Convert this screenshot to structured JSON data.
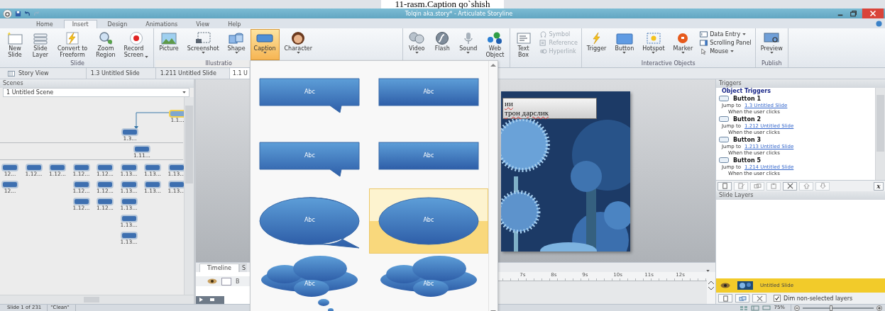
{
  "document_caption": "11-rasm.Caption qo`shish",
  "window": {
    "title": "Tolqin aka.story* -  Articulate Storyline"
  },
  "ribbon_tabs": [
    {
      "label": "Home",
      "selected": false
    },
    {
      "label": "Insert",
      "selected": true
    },
    {
      "label": "Design",
      "selected": false
    },
    {
      "label": "Animations",
      "selected": false
    },
    {
      "label": "View",
      "selected": false
    },
    {
      "label": "Help",
      "selected": false
    }
  ],
  "ribbon_groups": [
    {
      "label": "Slide",
      "buttons": [
        {
          "kind": "new-slide",
          "label": "New\nSlide",
          "dropdown": false,
          "selected": false
        },
        {
          "kind": "slide-layer",
          "label": "Slide\nLayer",
          "dropdown": false,
          "selected": false
        },
        {
          "kind": "freeform",
          "label": "Convert to\nFreeform",
          "dropdown": false,
          "selected": false
        },
        {
          "kind": "zoom",
          "label": "Zoom\nRegion",
          "dropdown": false,
          "selected": false
        },
        {
          "kind": "record",
          "label": "Record\nScreen",
          "dropdown": true,
          "selected": false
        }
      ]
    },
    {
      "label": "Illustratio",
      "buttons": [
        {
          "kind": "picture",
          "label": "Picture",
          "dropdown": false,
          "selected": false
        },
        {
          "kind": "screenshot",
          "label": "Screenshot",
          "dropdown": true,
          "selected": false
        },
        {
          "kind": "shape",
          "label": "Shape",
          "dropdown": true,
          "selected": false
        },
        {
          "kind": "caption",
          "label": "Caption",
          "dropdown": true,
          "selected": true
        },
        {
          "kind": "character",
          "label": "Character",
          "dropdown": true,
          "selected": false
        }
      ]
    },
    {
      "buttons": [
        {
          "kind": "video",
          "label": "Video",
          "dropdown": true,
          "selected": false
        },
        {
          "kind": "flash",
          "label": "Flash",
          "dropdown": false,
          "selected": false
        },
        {
          "kind": "sound",
          "label": "Sound",
          "dropdown": true,
          "selected": false
        },
        {
          "kind": "web",
          "label": "Web\nObject",
          "dropdown": false,
          "selected": false
        }
      ]
    },
    {
      "buttons": [
        {
          "kind": "textbox",
          "label": "Text\nBox",
          "dropdown": false,
          "selected": false
        }
      ],
      "small_buttons": [
        {
          "kind": "symbol",
          "label": "Symbol",
          "dropdown": false,
          "disabled": true
        },
        {
          "kind": "reference",
          "label": "Reference",
          "dropdown": false,
          "disabled": true
        },
        {
          "kind": "hyperlink",
          "label": "Hyperlink",
          "dropdown": false,
          "disabled": true
        }
      ]
    },
    {
      "label": "Interactive Objects",
      "buttons": [
        {
          "kind": "trigger",
          "label": "Trigger",
          "dropdown": false,
          "selected": false
        },
        {
          "kind": "button",
          "label": "Button",
          "dropdown": true,
          "selected": false
        },
        {
          "kind": "hotspot",
          "label": "Hotspot",
          "dropdown": true,
          "selected": false
        },
        {
          "kind": "marker",
          "label": "Marker",
          "dropdown": true,
          "selected": false
        }
      ],
      "small_buttons": [
        {
          "kind": "data-entry",
          "label": "Data Entry",
          "dropdown": true,
          "disabled": false
        },
        {
          "kind": "scrolling-panel",
          "label": "Scrolling Panel",
          "dropdown": false,
          "disabled": false
        },
        {
          "kind": "mouse",
          "label": "Mouse",
          "dropdown": true,
          "disabled": false
        }
      ]
    },
    {
      "label": "Publish",
      "buttons": [
        {
          "kind": "preview",
          "label": "Preview",
          "dropdown": true,
          "selected": false
        }
      ]
    }
  ],
  "caption_gallery": [
    {
      "kind": "rect-callout",
      "label": "Abc",
      "selected": false
    },
    {
      "kind": "rect",
      "label": "Abc",
      "selected": false
    },
    {
      "kind": "rect-callout",
      "label": "Abc",
      "selected": false
    },
    {
      "kind": "rect",
      "label": "Abc",
      "selected": false
    },
    {
      "kind": "oval-callout",
      "label": "Abc",
      "selected": false
    },
    {
      "kind": "oval",
      "label": "Abc",
      "selected": true
    },
    {
      "kind": "cloud-callout",
      "label": "Abc",
      "selected": false
    },
    {
      "kind": "cloud",
      "label": "Abc",
      "selected": false
    }
  ],
  "doc_tabs": [
    {
      "label": "Story View",
      "kind": "story",
      "selected": false
    },
    {
      "label": "1.3 Untitled Slide",
      "kind": "slide",
      "selected": false
    },
    {
      "label": "1.211 Untitled Slide",
      "kind": "slide",
      "selected": false
    },
    {
      "label": "1.1 U",
      "kind": "slide",
      "selected": true
    }
  ],
  "scenes_panel": {
    "title": "Scenes",
    "scene": "1 Untitled Scene",
    "tree": {
      "label": "1.1...",
      "selected": true,
      "children": [
        {
          "label": "1.3...",
          "selected": false,
          "children": [
            {
              "label": "1.11...",
              "selected": false,
              "children": [
                {
                  "label": "12...",
                  "selected": false,
                  "children": [
                    {
                      "label": "12...",
                      "selected": false
                    }
                  ]
                },
                {
                  "label": "1.12...",
                  "selected": false
                },
                {
                  "label": "1.12...",
                  "selected": false
                },
                {
                  "label": "1.12...",
                  "selected": false,
                  "children": [
                    {
                      "label": "1.12...",
                      "selected": false,
                      "children": [
                        {
                          "label": "1.12...",
                          "selected": false
                        }
                      ]
                    }
                  ]
                },
                {
                  "label": "1.12...",
                  "selected": false,
                  "children": [
                    {
                      "label": "1.12...",
                      "selected": false,
                      "children": [
                        {
                          "label": "1.12...",
                          "selected": false
                        }
                      ]
                    }
                  ]
                },
                {
                  "label": "1.13...",
                  "selected": false,
                  "children": [
                    {
                      "label": "1.13...",
                      "selected": false,
                      "children": [
                        {
                          "label": "1.13...",
                          "selected": false,
                          "children": [
                            {
                              "label": "1.13...",
                              "selected": false,
                              "children": [
                                {
                                  "label": "1.13...",
                                  "selected": false
                                }
                              ]
                            }
                          ]
                        }
                      ]
                    }
                  ]
                },
                {
                  "label": "1.13...",
                  "selected": false,
                  "children": [
                    {
                      "label": "1.13...",
                      "selected": false
                    }
                  ]
                },
                {
                  "label": "1.13...",
                  "selected": false,
                  "children": [
                    {
                      "label": "1.13...",
                      "selected": false
                    }
                  ]
                }
              ]
            }
          ]
        }
      ]
    }
  },
  "slide": {
    "kind": "picture",
    "text_lines": [
      "ии",
      "трон дарслик"
    ]
  },
  "timeline": {
    "tabs": [
      {
        "label": "Timeline",
        "selected": true
      },
      {
        "label": "S",
        "selected": false
      }
    ],
    "row_label": "B",
    "ruler": [
      "7s",
      "8s",
      "9s",
      "10s",
      "11s",
      "12s"
    ]
  },
  "triggers_panel": {
    "title": "Triggers",
    "heading": "Object Triggers",
    "items": [
      {
        "object": "Button 1",
        "action": "Jump to",
        "target": "1.3 Untitled Slide",
        "condition": "When the user clicks"
      },
      {
        "object": "Button 2",
        "action": "Jump to",
        "target": "1.212 Untitled Slide",
        "condition": "When the user clicks"
      },
      {
        "object": "Button 3",
        "action": "Jump to",
        "target": "1.213 Untitled Slide",
        "condition": "When the user clicks"
      },
      {
        "object": "Button 5",
        "action": "Jump to",
        "target": "1.214 Untitled Slide",
        "condition": "When the user clicks"
      }
    ],
    "toolbar": [
      {
        "kind": "new",
        "disabled": false
      },
      {
        "kind": "edit",
        "disabled": true
      },
      {
        "kind": "copy",
        "disabled": true
      },
      {
        "kind": "paste",
        "disabled": true
      },
      {
        "kind": "delete",
        "disabled": false
      },
      {
        "kind": "up",
        "disabled": true
      },
      {
        "kind": "down",
        "disabled": true
      }
    ],
    "variables_button": "x"
  },
  "layers_panel": {
    "title": "Slide Layers",
    "layers": [
      {
        "name": "Untitled Slide",
        "selected": true
      }
    ],
    "dim_option": {
      "label": "Dim non-selected layers",
      "checked": true
    }
  },
  "status_bar": {
    "slide": "Slide 1 of 231",
    "theme": "\"Clean\"",
    "zoom": "75%",
    "zoom_slider": {
      "level": 0.4
    }
  }
}
